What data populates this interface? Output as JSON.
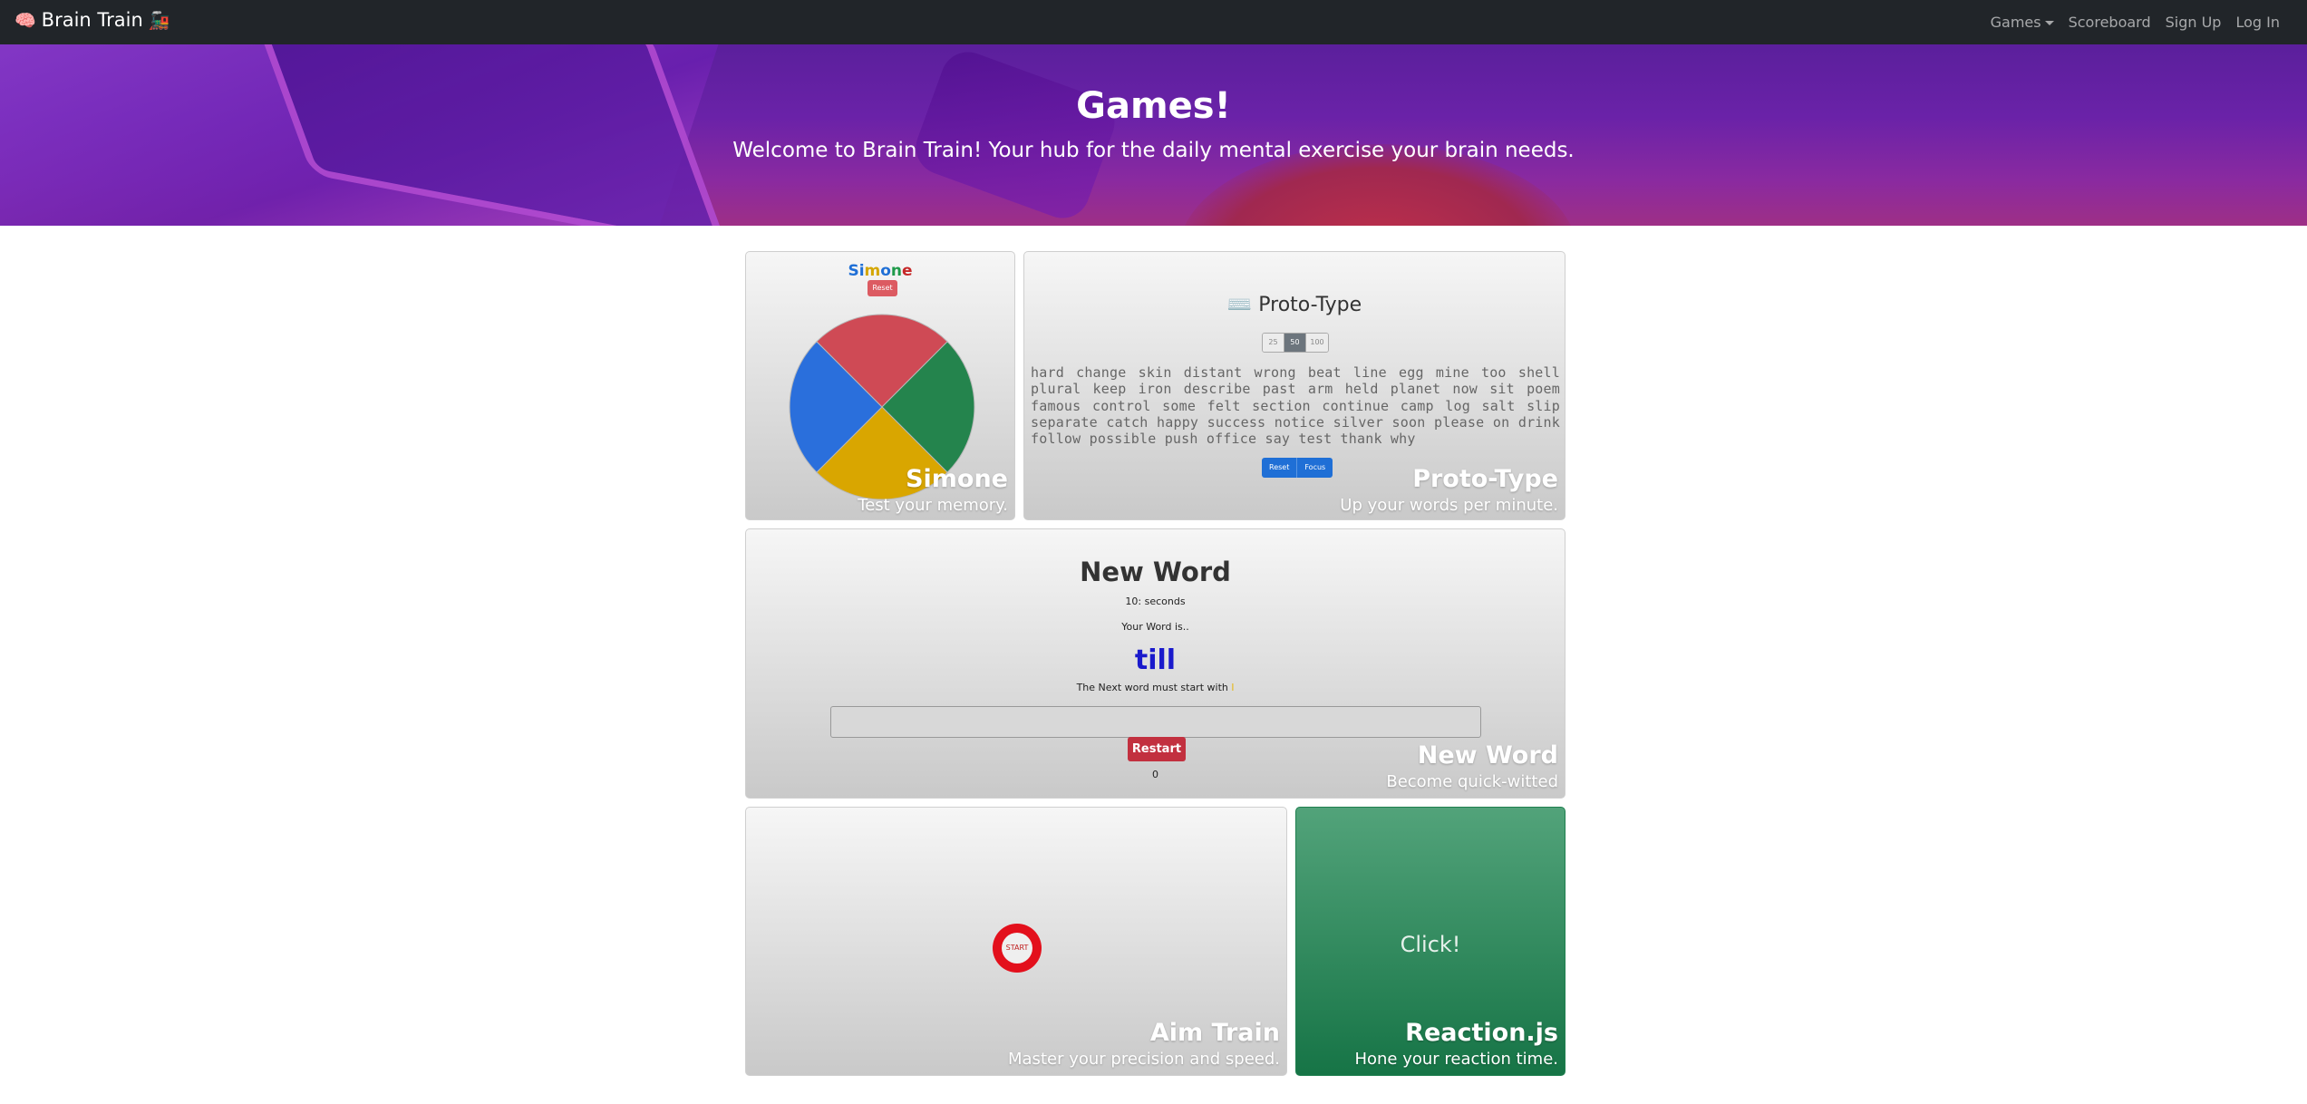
{
  "app": {
    "title": "Brain Train",
    "brain_emoji": "🧠",
    "train_emoji": "🚂"
  },
  "nav": {
    "games": "Games",
    "scoreboard": "Scoreboard",
    "signup": "Sign Up",
    "login": "Log In"
  },
  "hero": {
    "title": "Games!",
    "subtitle": "Welcome to Brain Train! Your hub for the daily mental exercise your brain needs."
  },
  "simone": {
    "heading_letters": [
      "S",
      "i",
      "m",
      "o",
      "n",
      "e"
    ],
    "heading_colors": [
      "#1f6fd6",
      "#1f6fd6",
      "#d4a600",
      "#1f6fd6",
      "#1f9a4a",
      "#c62828"
    ],
    "reset": "Reset",
    "title": "Simone",
    "text": "Test your memory.",
    "colors": {
      "red": "#cf4a55",
      "green": "#24844d",
      "blue": "#2a6fdc",
      "yellow": "#d9a600"
    }
  },
  "proto": {
    "icon": "⌨️",
    "heading": "Proto-Type",
    "options": [
      "25",
      "50",
      "100"
    ],
    "selected": "50",
    "words": "hard change skin distant wrong beat line egg mine too shell plural keep iron describe past arm held planet now sit poem famous control some felt section continue camp log salt slip separate catch happy success notice silver soon please on drink follow possible push office say test thank why",
    "reset": "Reset",
    "focus": "Focus",
    "title": "Proto-Type",
    "text": "Up your words per minute."
  },
  "newword": {
    "heading": "New Word",
    "timer": "10: seconds",
    "your_word": "Your Word is..",
    "word": "till",
    "next_prefix": "The Next word must start with",
    "next_letter": "l",
    "restart": "Restart",
    "score": "0",
    "title": "New Word",
    "text": "Become quick-witted"
  },
  "aim": {
    "start": "START",
    "title": "Aim Train",
    "text": "Master your precision and speed."
  },
  "reaction": {
    "click": "Click!",
    "title": "Reaction.js",
    "text": "Hone your reaction time."
  }
}
